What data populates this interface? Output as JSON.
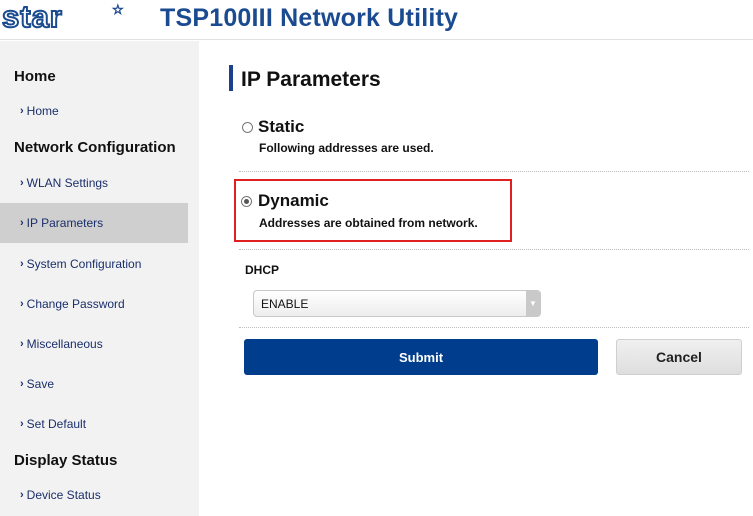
{
  "header": {
    "logo_text": "star",
    "title": "TSP100III Network Utility"
  },
  "sidebar": {
    "sections": [
      {
        "heading": "Home",
        "items": [
          {
            "label": "Home",
            "active": false
          }
        ]
      },
      {
        "heading": "Network Configuration",
        "items": [
          {
            "label": "WLAN Settings",
            "active": false
          },
          {
            "label": "IP Parameters",
            "active": true
          },
          {
            "label": "System Configuration",
            "active": false
          },
          {
            "label": "Change Password",
            "active": false
          },
          {
            "label": "Miscellaneous",
            "active": false
          },
          {
            "label": "Save",
            "active": false
          },
          {
            "label": "Set Default",
            "active": false
          }
        ]
      },
      {
        "heading": "Display Status",
        "items": [
          {
            "label": "Device Status",
            "active": false
          }
        ]
      }
    ],
    "chevron": "›"
  },
  "main": {
    "title": "IP Parameters",
    "options": [
      {
        "label": "Static",
        "description": "Following addresses are used.",
        "selected": false
      },
      {
        "label": "Dynamic",
        "description": "Addresses are obtained from network.",
        "selected": true
      }
    ],
    "dhcp": {
      "label": "DHCP",
      "selected_value": "ENABLE"
    },
    "submit_label": "Submit",
    "cancel_label": "Cancel"
  },
  "colors": {
    "brand_blue": "#1a4a8f",
    "submit_blue": "#003d8d",
    "highlight_red": "#e02020",
    "sidebar_bg": "#f2f2f2",
    "active_item_bg": "#cfcfcf"
  }
}
